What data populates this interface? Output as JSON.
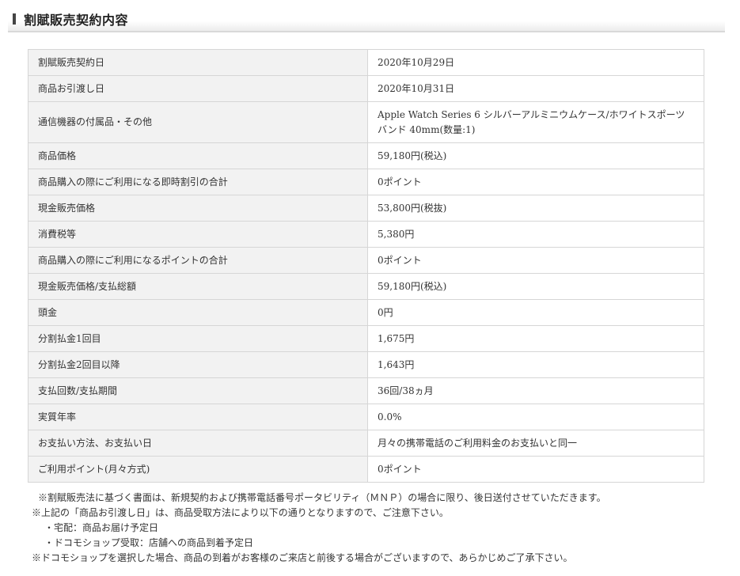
{
  "section": {
    "title": "割賦販売契約内容"
  },
  "rows": [
    {
      "label": "割賦販売契約日",
      "value": "2020年10月29日"
    },
    {
      "label": "商品お引渡し日",
      "value": "2020年10月31日"
    },
    {
      "label": "通信機器の付属品・その他",
      "value": "Apple Watch Series 6 シルバーアルミニウムケース/ホワイトスポーツバンド 40mm(数量:1)"
    },
    {
      "label": "商品価格",
      "value": "59,180円(税込)"
    },
    {
      "label": "商品購入の際にご利用になる即時割引の合計",
      "value": "0ポイント"
    },
    {
      "label": "現金販売価格",
      "value": "53,800円(税抜)"
    },
    {
      "label": "消費税等",
      "value": "5,380円"
    },
    {
      "label": "商品購入の際にご利用になるポイントの合計",
      "value": "0ポイント"
    },
    {
      "label": "現金販売価格/支払総額",
      "value": "59,180円(税込)"
    },
    {
      "label": "頭金",
      "value": "0円"
    },
    {
      "label": "分割払金1回目",
      "value": "1,675円"
    },
    {
      "label": "分割払金2回目以降",
      "value": "1,643円"
    },
    {
      "label": "支払回数/支払期間",
      "value": "36回/38ヵ月"
    },
    {
      "label": "実質年率",
      "value": "0.0%"
    },
    {
      "label": "お支払い方法、お支払い日",
      "value": "月々の携帯電話のご利用料金のお支払いと同一"
    },
    {
      "label": "ご利用ポイント(月々方式)",
      "value": "0ポイント"
    }
  ],
  "notes": [
    "※割賦販売法に基づく書面は、新規契約および携帯電話番号ポータビリティ（ＭＮＰ）の場合に限り、後日送付させていただきます。",
    "※上記の「商品お引渡し日」は、商品受取方法により以下の通りとなりますので、ご注意下さい。",
    "・宅配：商品お届け予定日",
    "・ドコモショップ受取：店舗への商品到着予定日",
    "※ドコモショップを選択した場合、商品の到着がお客様のご来店と前後する場合がございますので、あらかじめご了承下さい。"
  ]
}
